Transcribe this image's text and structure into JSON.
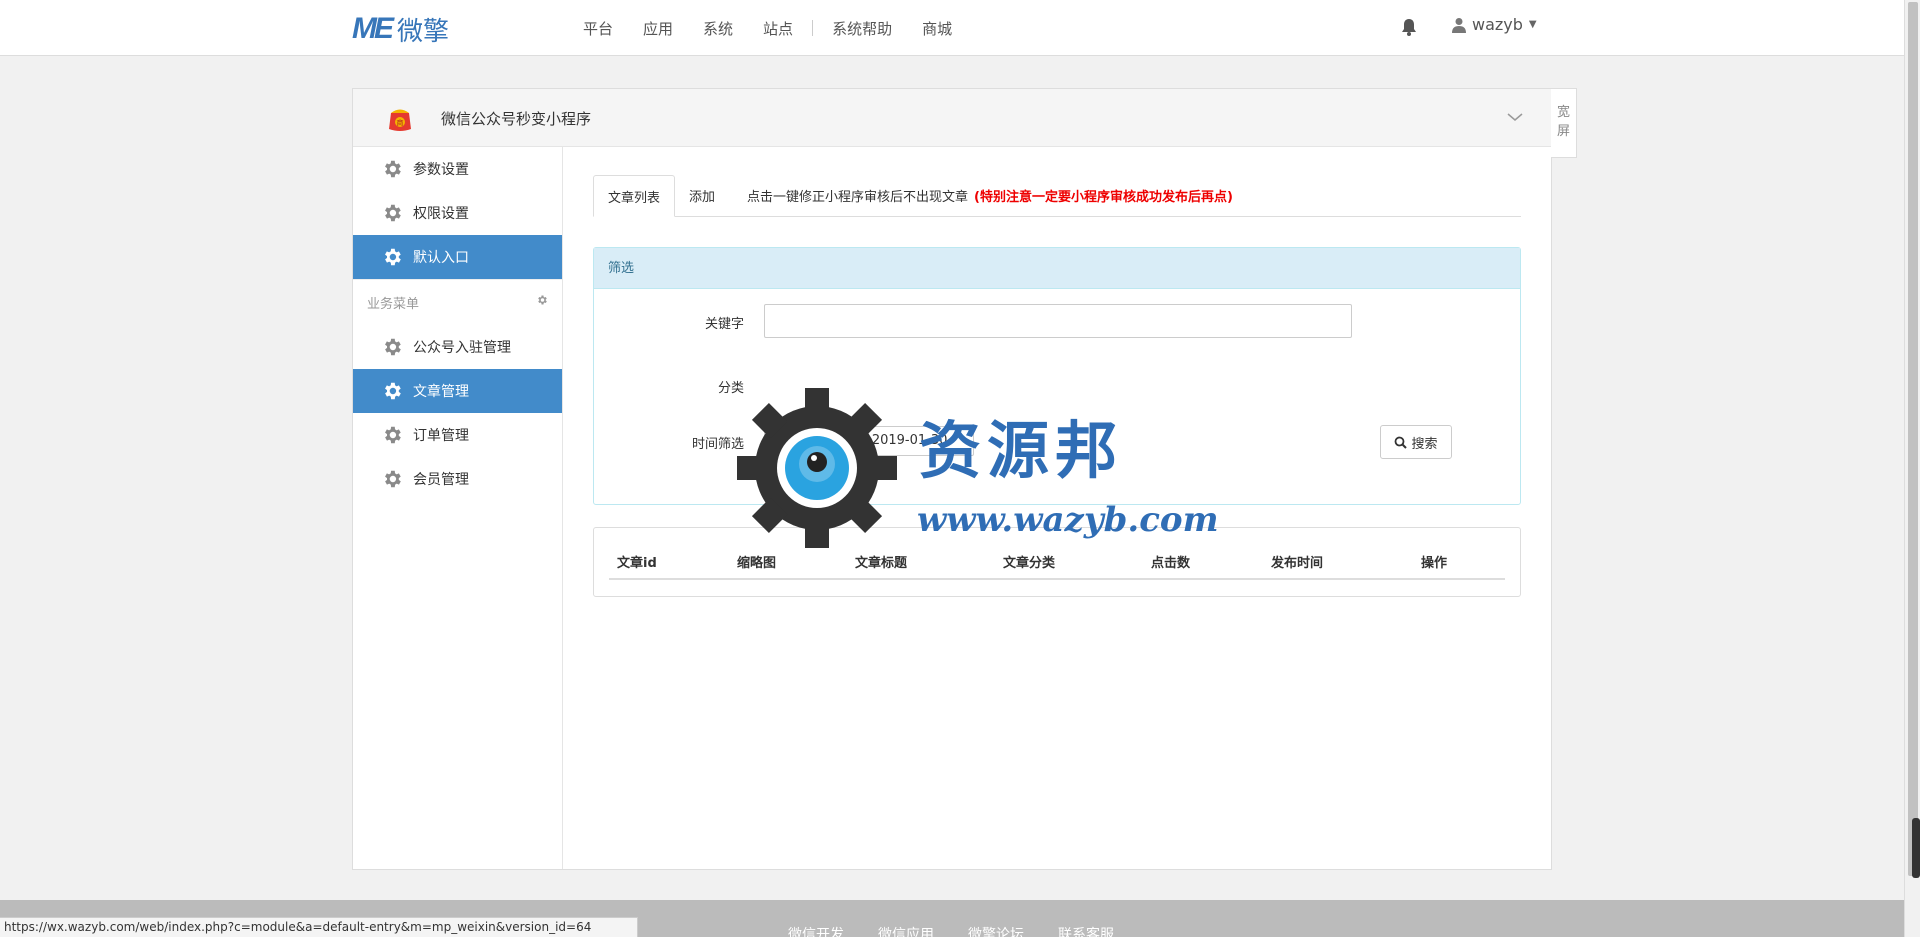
{
  "header": {
    "logo_mark": "ME",
    "logo_text": "微擎",
    "nav": [
      "平台",
      "应用",
      "系统",
      "站点",
      "系统帮助",
      "商城"
    ],
    "user": "wazyb"
  },
  "app": {
    "title": "微信公众号秒变小程序",
    "wide_label": "宽屏"
  },
  "sidebar": {
    "top_items": [
      "参数设置",
      "权限设置",
      "默认入口"
    ],
    "section_title": "业务菜单",
    "items": [
      "公众号入驻管理",
      "文章管理",
      "订单管理",
      "会员管理"
    ]
  },
  "tabs": {
    "list_label": "文章列表",
    "add_label": "添加",
    "note": "点击一键修正小程序审核后不出现文章",
    "warning": "(特别注意一定要小程序审核成功发布后再点)"
  },
  "filter": {
    "title": "筛选",
    "keyword_label": "关键字",
    "keyword_value": "",
    "category_label": "分类",
    "time_label": "时间筛选",
    "date_range": "2019-01-30 至 2019-01-30",
    "search_label": "搜索"
  },
  "table": {
    "columns": [
      "文章id",
      "缩略图",
      "文章标题",
      "文章分类",
      "点击数",
      "发布时间",
      "操作"
    ]
  },
  "watermark": {
    "text": "资源邦",
    "url": "www.wazyb.com"
  },
  "footer": {
    "links": [
      "微信开发",
      "微信应用",
      "微擎论坛",
      "联系客服"
    ]
  },
  "status_url": "https://wx.wazyb.com/web/index.php?c=module&a=default-entry&m=mp_weixin&version_id=64",
  "colors": {
    "brand": "#3776b9",
    "active": "#428bca",
    "warning": "#ee0000"
  }
}
